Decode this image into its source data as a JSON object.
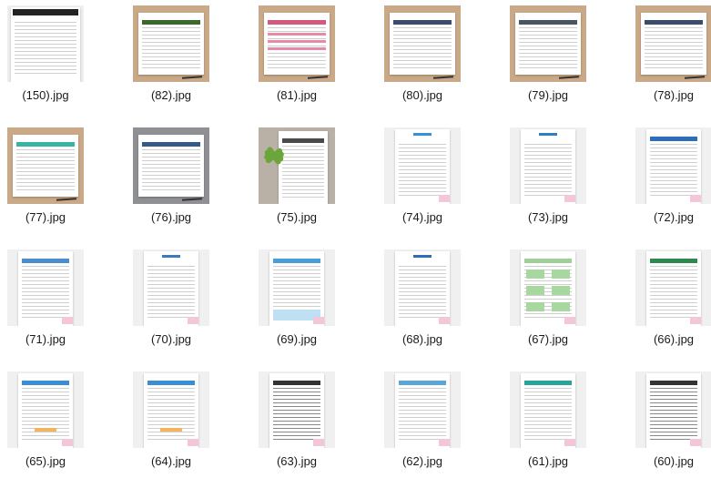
{
  "files": [
    {
      "name": "(150).jpg",
      "bg": "#efefef",
      "accent": "#222222",
      "style": "plain-dark"
    },
    {
      "name": "(82).jpg",
      "bg": "#c9a987",
      "accent": "#3a6a2e",
      "style": "wood-green"
    },
    {
      "name": "(81).jpg",
      "bg": "#c9a987",
      "accent": "#d45a7d",
      "style": "wood-pink"
    },
    {
      "name": "(80).jpg",
      "bg": "#c9a987",
      "accent": "#3c4d6b",
      "style": "wood-navy"
    },
    {
      "name": "(79).jpg",
      "bg": "#c9a987",
      "accent": "#4b5564",
      "style": "wood-gray"
    },
    {
      "name": "(78).jpg",
      "bg": "#c9a987",
      "accent": "#3b4d6b",
      "style": "wood-navy2"
    },
    {
      "name": "(77).jpg",
      "bg": "#c9a987",
      "accent": "#3ab3a4",
      "style": "wood-teal"
    },
    {
      "name": "(76).jpg",
      "bg": "#8e9093",
      "accent": "#345a8a",
      "style": "gray-blue"
    },
    {
      "name": "(75).jpg",
      "bg": "#b9b1a6",
      "accent": "#4a4a4a",
      "style": "plant"
    },
    {
      "name": "(74).jpg",
      "bg": "#f0f0f0",
      "accent": "#3c8fd6",
      "style": "plain-blue"
    },
    {
      "name": "(73).jpg",
      "bg": "#f0f0f0",
      "accent": "#2f7fc4",
      "style": "plain-blue2"
    },
    {
      "name": "(72).jpg",
      "bg": "#f0f0f0",
      "accent": "#2c6fb8",
      "style": "plain-blue3"
    },
    {
      "name": "(71).jpg",
      "bg": "#f0f0f0",
      "accent": "#4a8ed0",
      "style": "plain-blue4"
    },
    {
      "name": "(70).jpg",
      "bg": "#f0f0f0",
      "accent": "#3a7bc0",
      "style": "plain-blue5"
    },
    {
      "name": "(69).jpg",
      "bg": "#f0f0f0",
      "accent": "#4b9ed8",
      "style": "plain-lightblue"
    },
    {
      "name": "(68).jpg",
      "bg": "#f0f0f0",
      "accent": "#2f6db4",
      "style": "plain-text"
    },
    {
      "name": "(67).jpg",
      "bg": "#f0f0f0",
      "accent": "#9fd09a",
      "style": "plain-green"
    },
    {
      "name": "(66).jpg",
      "bg": "#f0f0f0",
      "accent": "#2d8a4e",
      "style": "plain-green2"
    },
    {
      "name": "(65).jpg",
      "bg": "#f0f0f0",
      "accent": "#3a8fd4",
      "style": "plain-blue6"
    },
    {
      "name": "(64).jpg",
      "bg": "#f0f0f0",
      "accent": "#3a8fd4",
      "style": "plain-blue7"
    },
    {
      "name": "(63).jpg",
      "bg": "#f0f0f0",
      "accent": "#333333",
      "style": "plain-dense"
    },
    {
      "name": "(62).jpg",
      "bg": "#f0f0f0",
      "accent": "#5aa6d6",
      "style": "plain-lightblue2"
    },
    {
      "name": "(61).jpg",
      "bg": "#f0f0f0",
      "accent": "#2aa39a",
      "style": "plain-teal"
    },
    {
      "name": "(60).jpg",
      "bg": "#f0f0f0",
      "accent": "#333333",
      "style": "plain-dense2"
    }
  ]
}
